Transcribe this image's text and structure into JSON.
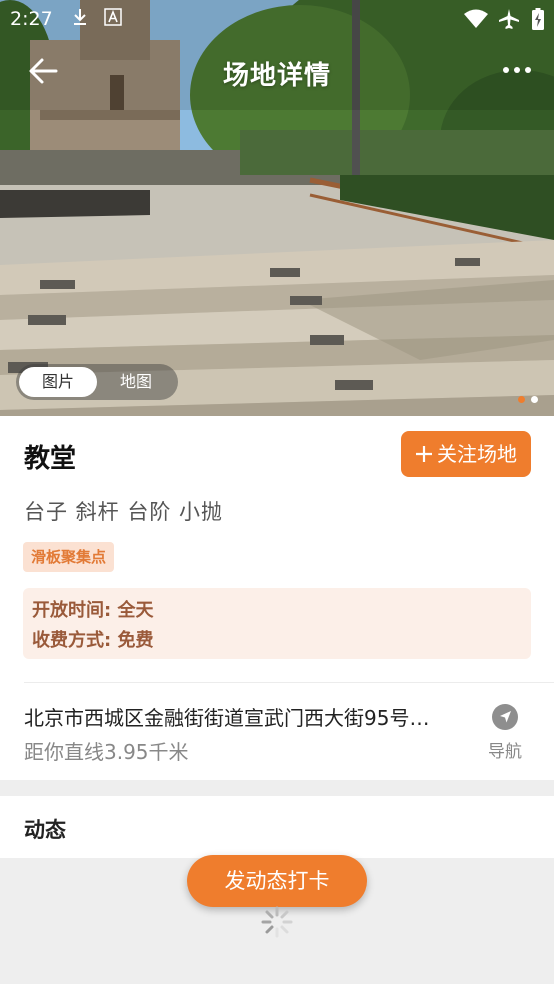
{
  "status_bar": {
    "time": "2:27",
    "icons": [
      "download-icon",
      "font-icon",
      "wifi-icon",
      "airplane-icon",
      "battery-icon"
    ]
  },
  "header": {
    "title": "场地详情",
    "back_icon": "back-arrow-icon",
    "more_icon": "more-dots-icon"
  },
  "gallery": {
    "tabs": [
      "图片",
      "地图"
    ],
    "active_tab": "图片",
    "page_count": 2,
    "current_page": 1
  },
  "venue": {
    "name": "教堂",
    "follow_label": "关注场地",
    "follow_icon": "plus-icon",
    "features": "台子 斜杆 台阶 小抛",
    "tag": "滑板聚集点",
    "hours": "开放时间: 全天",
    "fee": "收费方式: 免费",
    "address": "北京市西城区金融街街道宣武门西大街95号…",
    "distance": "距你直线3.95千米",
    "nav_label": "导航",
    "nav_icon": "navigation-arrow-icon"
  },
  "activity": {
    "title": "动态",
    "post_button": "发动态打卡",
    "loading_icon": "loading-spinner-icon"
  },
  "colors": {
    "accent": "#ef7d2d",
    "tag_bg": "#fbe1d2",
    "info_bg": "#fcefe8",
    "info_text": "#9a5a3a"
  }
}
